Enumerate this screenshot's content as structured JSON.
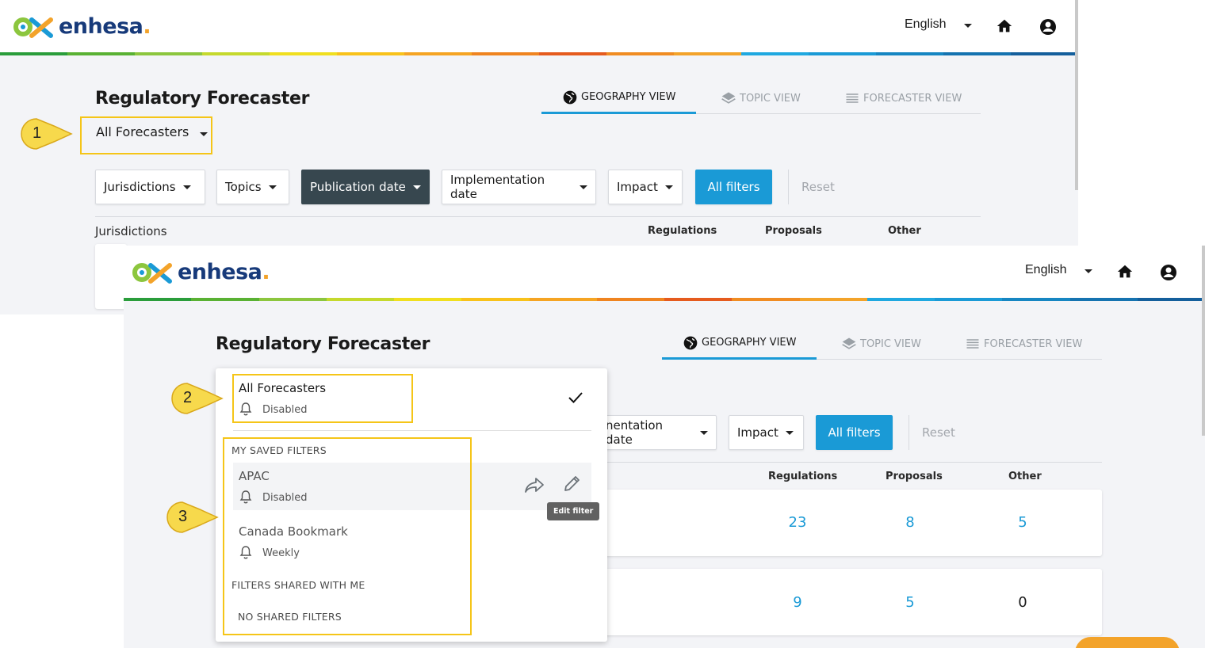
{
  "brand": {
    "name": "enhesa",
    "dot": "."
  },
  "header": {
    "language": "English"
  },
  "stripe_colors": [
    "#2a9d3b",
    "#59b133",
    "#8cc63e",
    "#c5d92d",
    "#f0df1f",
    "#f8c21b",
    "#f5a423",
    "#ef8420",
    "#e55b1e",
    "#f08c22",
    "#f3a32a",
    "#1fa8e0",
    "#1a9ad6",
    "#1686c2",
    "#1573b0",
    "#145f9c"
  ],
  "colors": {
    "accent": "#1a9ad6",
    "highlight": "#f5c518",
    "dark_button": "#37474f"
  },
  "page": {
    "title": "Regulatory Forecaster"
  },
  "tabs": [
    {
      "label": "GEOGRAPHY VIEW",
      "icon": "globe-icon",
      "active": true
    },
    {
      "label": "TOPIC VIEW",
      "icon": "layers-icon",
      "active": false
    },
    {
      "label": "FORECASTER VIEW",
      "icon": "list-icon",
      "active": false
    }
  ],
  "forecaster_select": {
    "value": "All Forecasters"
  },
  "filters": {
    "jurisdictions": "Jurisdictions",
    "topics": "Topics",
    "publication_date": "Publication date",
    "implementation_date": "Implementation date",
    "implementation_date_partial": "nentation date",
    "impact": "Impact",
    "all_filters": "All filters",
    "reset": "Reset"
  },
  "table": {
    "headers": {
      "jurisdictions": "Jurisdictions",
      "regulations": "Regulations",
      "proposals": "Proposals",
      "other": "Other"
    },
    "rows": [
      {
        "regulations": "23",
        "proposals": "8",
        "other": "5"
      },
      {
        "regulations": "9",
        "proposals": "5",
        "other": "0"
      }
    ]
  },
  "callouts": [
    "1",
    "2",
    "3"
  ],
  "menu": {
    "all_forecasters": {
      "title": "All Forecasters",
      "status": "Disabled"
    },
    "my_saved_heading": "MY SAVED FILTERS",
    "saved": [
      {
        "title": "APAC",
        "status": "Disabled"
      },
      {
        "title": "Canada Bookmark",
        "status": "Weekly"
      }
    ],
    "shared_heading": "FILTERS SHARED WITH ME",
    "no_shared": "NO SHARED FILTERS",
    "tooltip": "Edit filter"
  }
}
